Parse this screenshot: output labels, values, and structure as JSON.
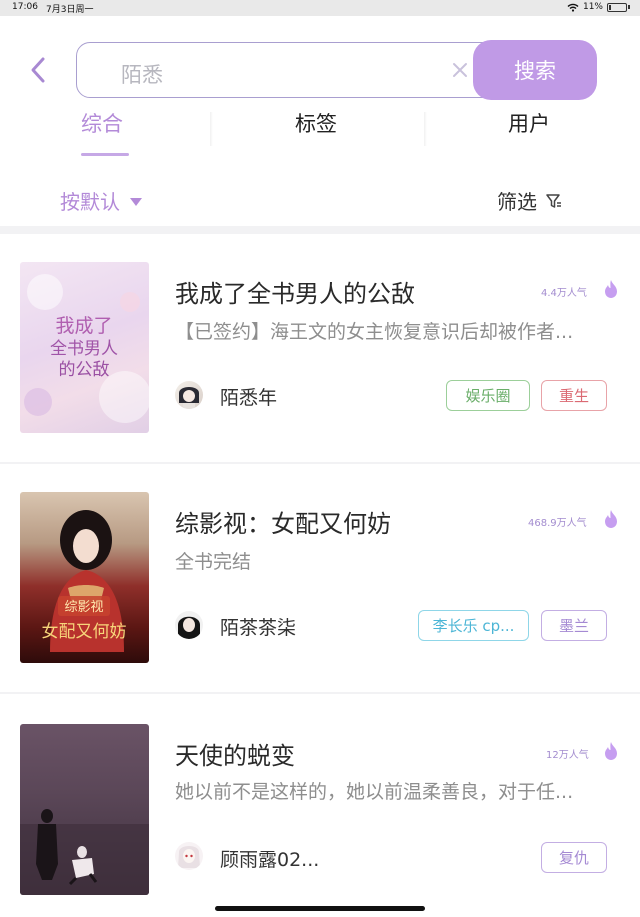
{
  "status_bar": {
    "time": "17:06",
    "date": "7月3日周一",
    "battery": "11%"
  },
  "search": {
    "query": "陌悉",
    "button_label": "搜索"
  },
  "tabs": [
    {
      "label": "综合",
      "active": true
    },
    {
      "label": "标签",
      "active": false
    },
    {
      "label": "用户",
      "active": false
    }
  ],
  "sort": {
    "label": "按默认"
  },
  "filter": {
    "label": "筛选"
  },
  "results": [
    {
      "title": "我成了全书男人的公敌",
      "description": "【已签约】海王文的女主恢复意识后却被作者...",
      "popularity": "4.4万人气",
      "author": "陌悉年",
      "tags": [
        {
          "label": "娱乐圈",
          "color": "green"
        },
        {
          "label": "重生",
          "color": "red"
        }
      ],
      "cover_text": [
        "我成了",
        "全书男人",
        "的公敌"
      ]
    },
    {
      "title": "综影视：女配又何妨",
      "description": "全书完结",
      "popularity": "468.9万人气",
      "author": "陌茶茶柒",
      "tags": [
        {
          "label": "李长乐 cp...",
          "color": "cyan"
        },
        {
          "label": "墨兰",
          "color": "purple"
        }
      ],
      "cover_text": [
        "综影视",
        "女配又何妨"
      ]
    },
    {
      "title": "天使的蜕变",
      "description": "她以前不是这样的，她以前温柔善良，对于任...",
      "popularity": "12万人气",
      "author": "顾雨露02...",
      "tags": [
        {
          "label": "复仇",
          "color": "purple"
        }
      ],
      "cover_text": []
    }
  ],
  "colors": {
    "accent": "#b38ad8",
    "search_button": "#c09ae6"
  }
}
